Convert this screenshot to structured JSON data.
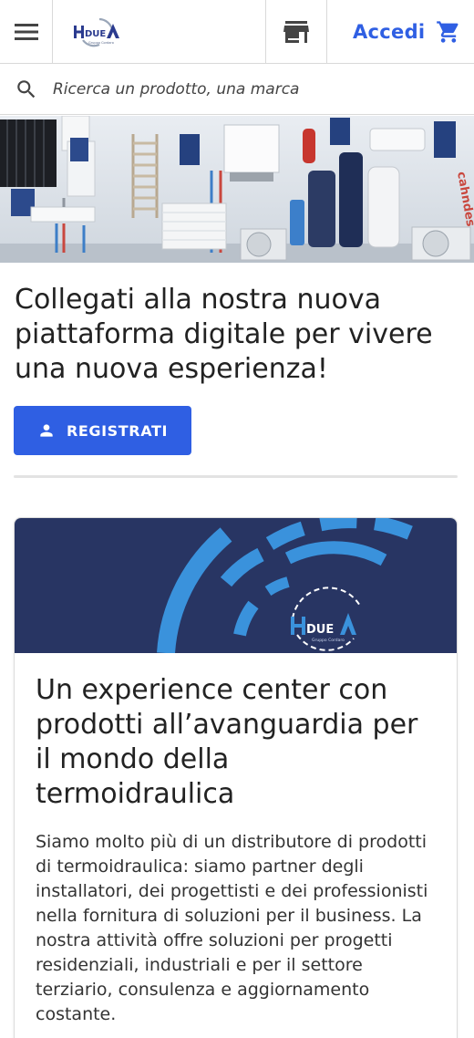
{
  "header": {
    "logo_text": "DUE",
    "logo_subtext": "Gruppo Cordaro",
    "login_label": "Accedi"
  },
  "search": {
    "placeholder": "Ricerca un prodotto, una marca"
  },
  "hero": {
    "image_alt": "Showroom prodotti termoidraulici",
    "image_sign": "cahndes"
  },
  "intro": {
    "title": "Collegati alla nostra nuova piattaforma digitale per vivere una nuova esperienza!",
    "register_label": "REGISTRATI"
  },
  "card": {
    "banner_logo_text": "DUE",
    "banner_logo_subtext": "Gruppo Cordaro",
    "title": "Un experience center con prodotti all’avanguardia per il mondo della termoidraulica",
    "text": "Siamo molto più di un distributore di prodotti di termoidraulica: siamo partner degli installatori, dei progettisti e dei professionisti nella fornitura di soluzioni per il business. La nostra attività offre soluzioni per progetti residenziali, industriali e per il settore terziario, consulenza e aggiornamento costante."
  },
  "colors": {
    "accent": "#2f5fe3",
    "banner_bg": "#283563",
    "banner_arc": "#3a92dc"
  },
  "icons": {
    "menu": "menu-icon",
    "store": "store-icon",
    "cart": "cart-icon",
    "search": "search-icon",
    "person": "person-icon"
  }
}
